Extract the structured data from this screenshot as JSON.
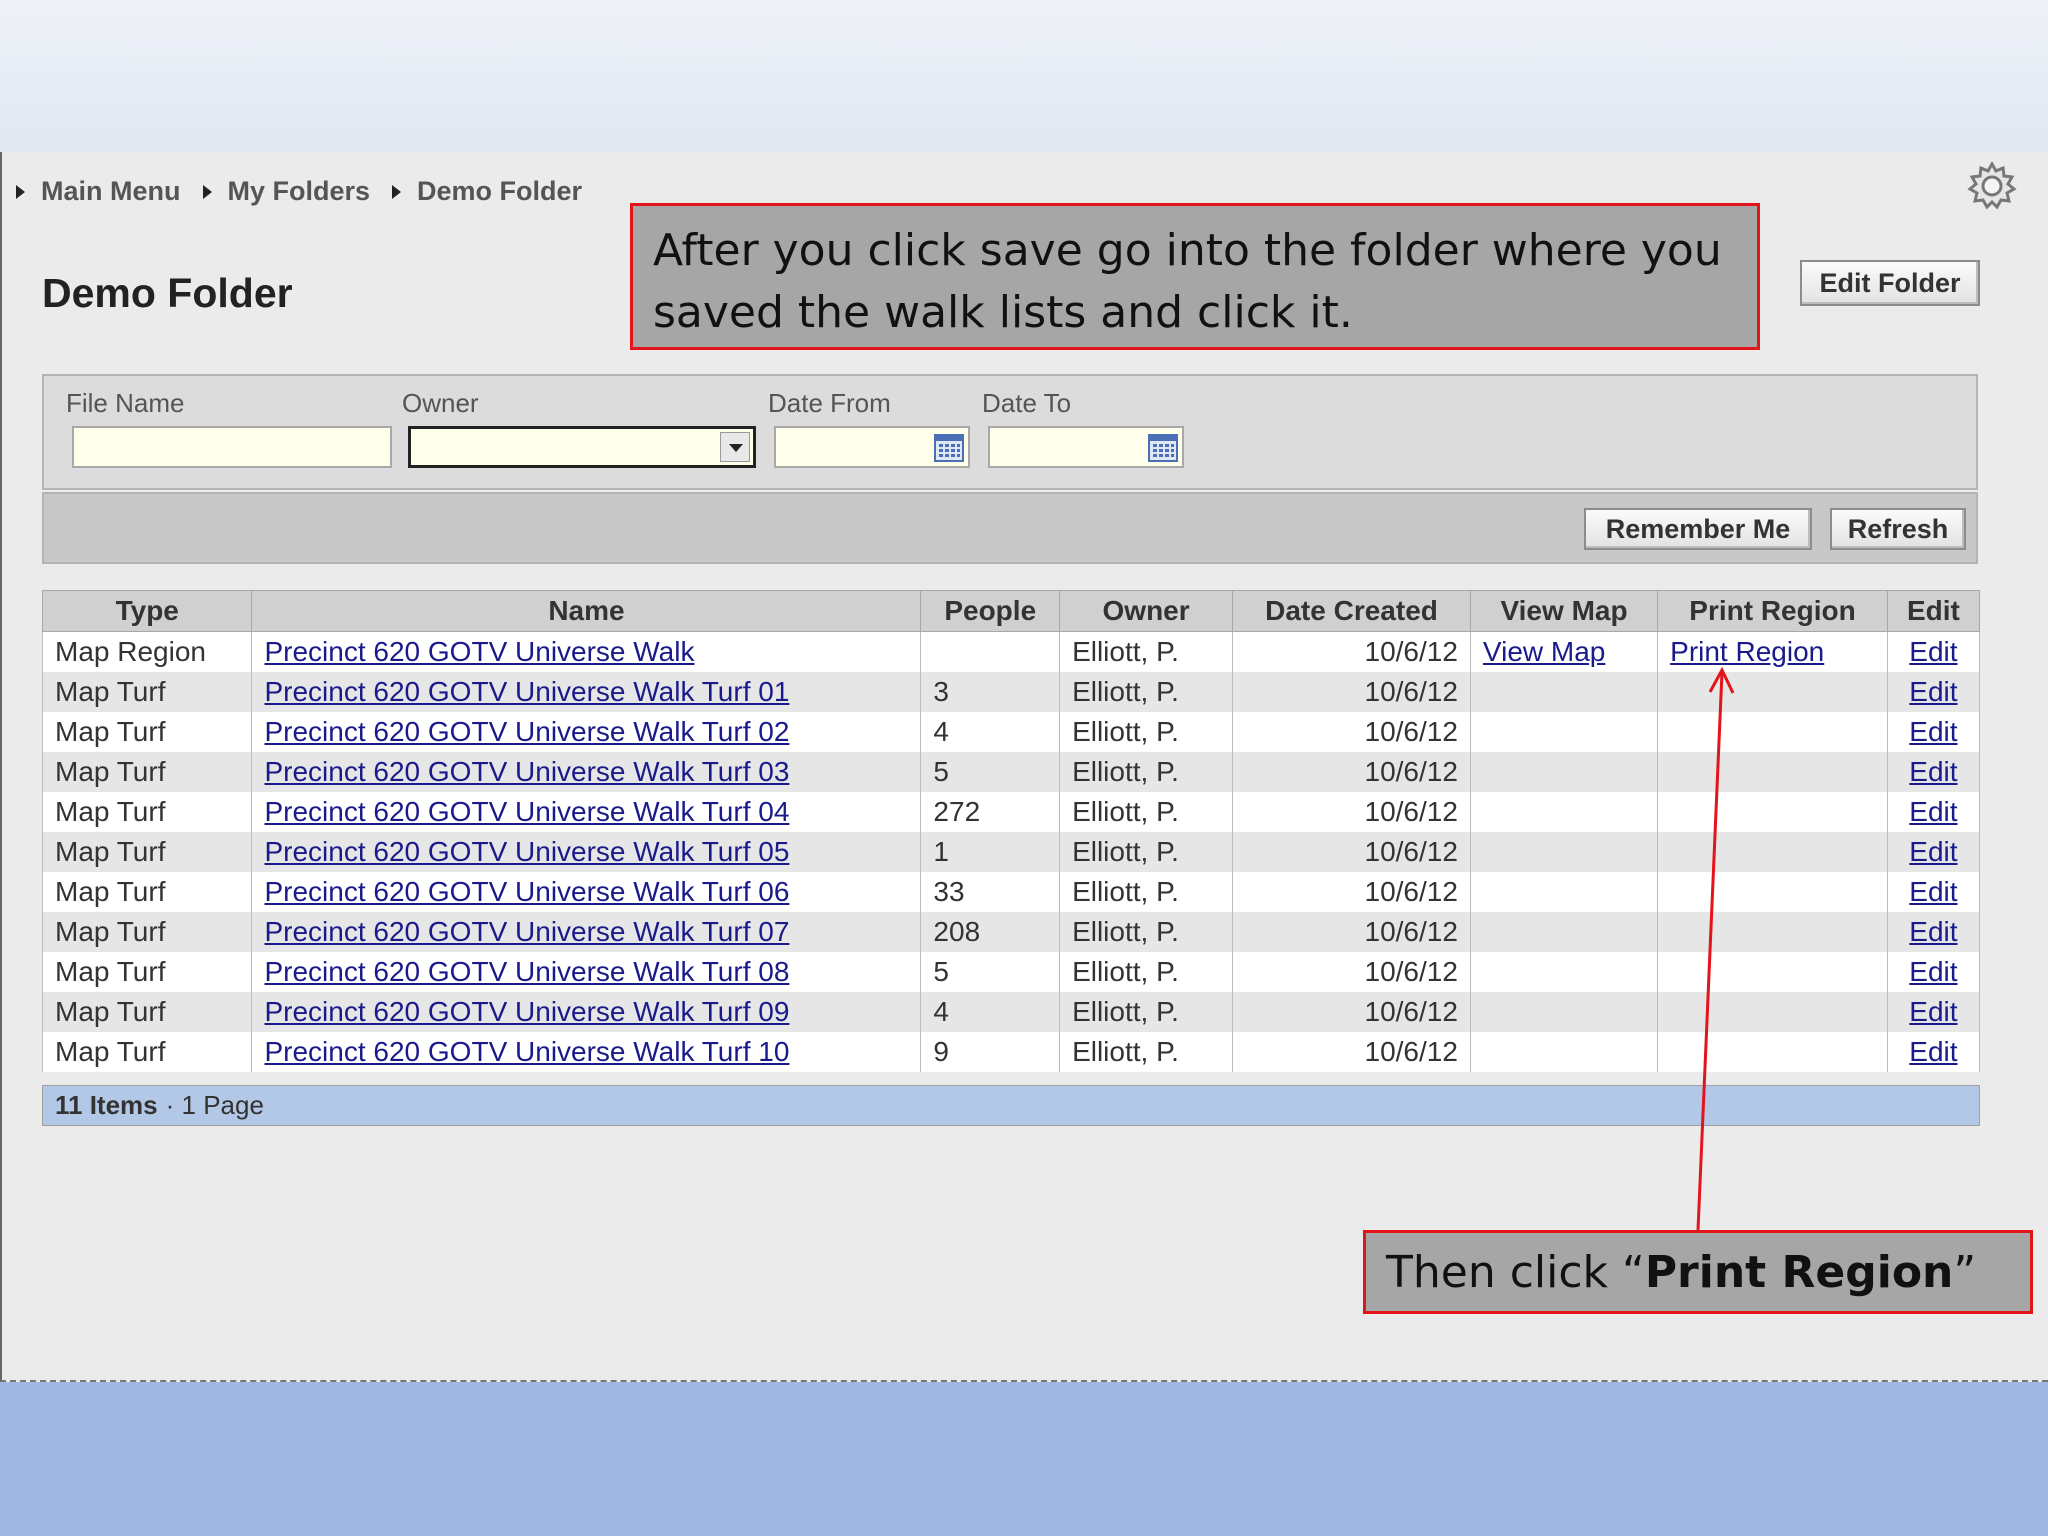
{
  "breadcrumb": [
    "Main Menu",
    "My Folders",
    "Demo Folder"
  ],
  "page_title": "Demo Folder",
  "edit_folder_label": "Edit Folder",
  "filters": {
    "file_name_label": "File Name",
    "owner_label": "Owner",
    "date_from_label": "Date From",
    "date_to_label": "Date To",
    "file_name_value": "",
    "owner_value": "",
    "date_from_value": "",
    "date_to_value": ""
  },
  "actions": {
    "remember_me": "Remember Me",
    "refresh": "Refresh"
  },
  "table": {
    "columns": [
      "Type",
      "Name",
      "People",
      "Owner",
      "Date Created",
      "View Map",
      "Print Region",
      "Edit"
    ],
    "rows": [
      {
        "type": "Map Region",
        "name": "Precinct 620 GOTV Universe Walk",
        "people": "",
        "owner": "Elliott, P.",
        "date": "10/6/12",
        "view_map": "View Map",
        "print_region": "Print Region",
        "edit": "Edit"
      },
      {
        "type": "Map Turf",
        "name": "Precinct 620 GOTV Universe Walk Turf 01",
        "people": "3",
        "owner": "Elliott, P.",
        "date": "10/6/12",
        "view_map": "",
        "print_region": "",
        "edit": "Edit"
      },
      {
        "type": "Map Turf",
        "name": "Precinct 620 GOTV Universe Walk Turf 02",
        "people": "4",
        "owner": "Elliott, P.",
        "date": "10/6/12",
        "view_map": "",
        "print_region": "",
        "edit": "Edit"
      },
      {
        "type": "Map Turf",
        "name": "Precinct 620 GOTV Universe Walk Turf 03",
        "people": "5",
        "owner": "Elliott, P.",
        "date": "10/6/12",
        "view_map": "",
        "print_region": "",
        "edit": "Edit"
      },
      {
        "type": "Map Turf",
        "name": "Precinct 620 GOTV Universe Walk Turf 04",
        "people": "272",
        "owner": "Elliott, P.",
        "date": "10/6/12",
        "view_map": "",
        "print_region": "",
        "edit": "Edit"
      },
      {
        "type": "Map Turf",
        "name": "Precinct 620 GOTV Universe Walk Turf 05",
        "people": "1",
        "owner": "Elliott, P.",
        "date": "10/6/12",
        "view_map": "",
        "print_region": "",
        "edit": "Edit"
      },
      {
        "type": "Map Turf",
        "name": "Precinct 620 GOTV Universe Walk Turf 06",
        "people": "33",
        "owner": "Elliott, P.",
        "date": "10/6/12",
        "view_map": "",
        "print_region": "",
        "edit": "Edit"
      },
      {
        "type": "Map Turf",
        "name": "Precinct 620 GOTV Universe Walk Turf 07",
        "people": "208",
        "owner": "Elliott, P.",
        "date": "10/6/12",
        "view_map": "",
        "print_region": "",
        "edit": "Edit"
      },
      {
        "type": "Map Turf",
        "name": "Precinct 620 GOTV Universe Walk Turf 08",
        "people": "5",
        "owner": "Elliott, P.",
        "date": "10/6/12",
        "view_map": "",
        "print_region": "",
        "edit": "Edit"
      },
      {
        "type": "Map Turf",
        "name": "Precinct 620 GOTV Universe Walk Turf 09",
        "people": "4",
        "owner": "Elliott, P.",
        "date": "10/6/12",
        "view_map": "",
        "print_region": "",
        "edit": "Edit"
      },
      {
        "type": "Map Turf",
        "name": "Precinct 620 GOTV Universe Walk Turf 10",
        "people": "9",
        "owner": "Elliott, P.",
        "date": "10/6/12",
        "view_map": "",
        "print_region": "",
        "edit": "Edit"
      }
    ]
  },
  "footer": {
    "items": "11 Items",
    "pages": "· 1 Page"
  },
  "callouts": {
    "first": "After you click save go into the folder where you saved the walk lists and click it.",
    "second_prefix": "Then click “",
    "second_bold": "Print Region",
    "second_suffix": "”"
  },
  "colors": {
    "callout_border": "#e3141b",
    "callout_fill": "#a6a6a6",
    "link": "#1a1a8c",
    "footer_bar": "#b3c8e6"
  },
  "icons": {
    "settings": "gear-icon",
    "calendar": "calendar-icon",
    "dropdown": "chevron-down-icon",
    "breadcrumb": "triangle-right-icon"
  }
}
